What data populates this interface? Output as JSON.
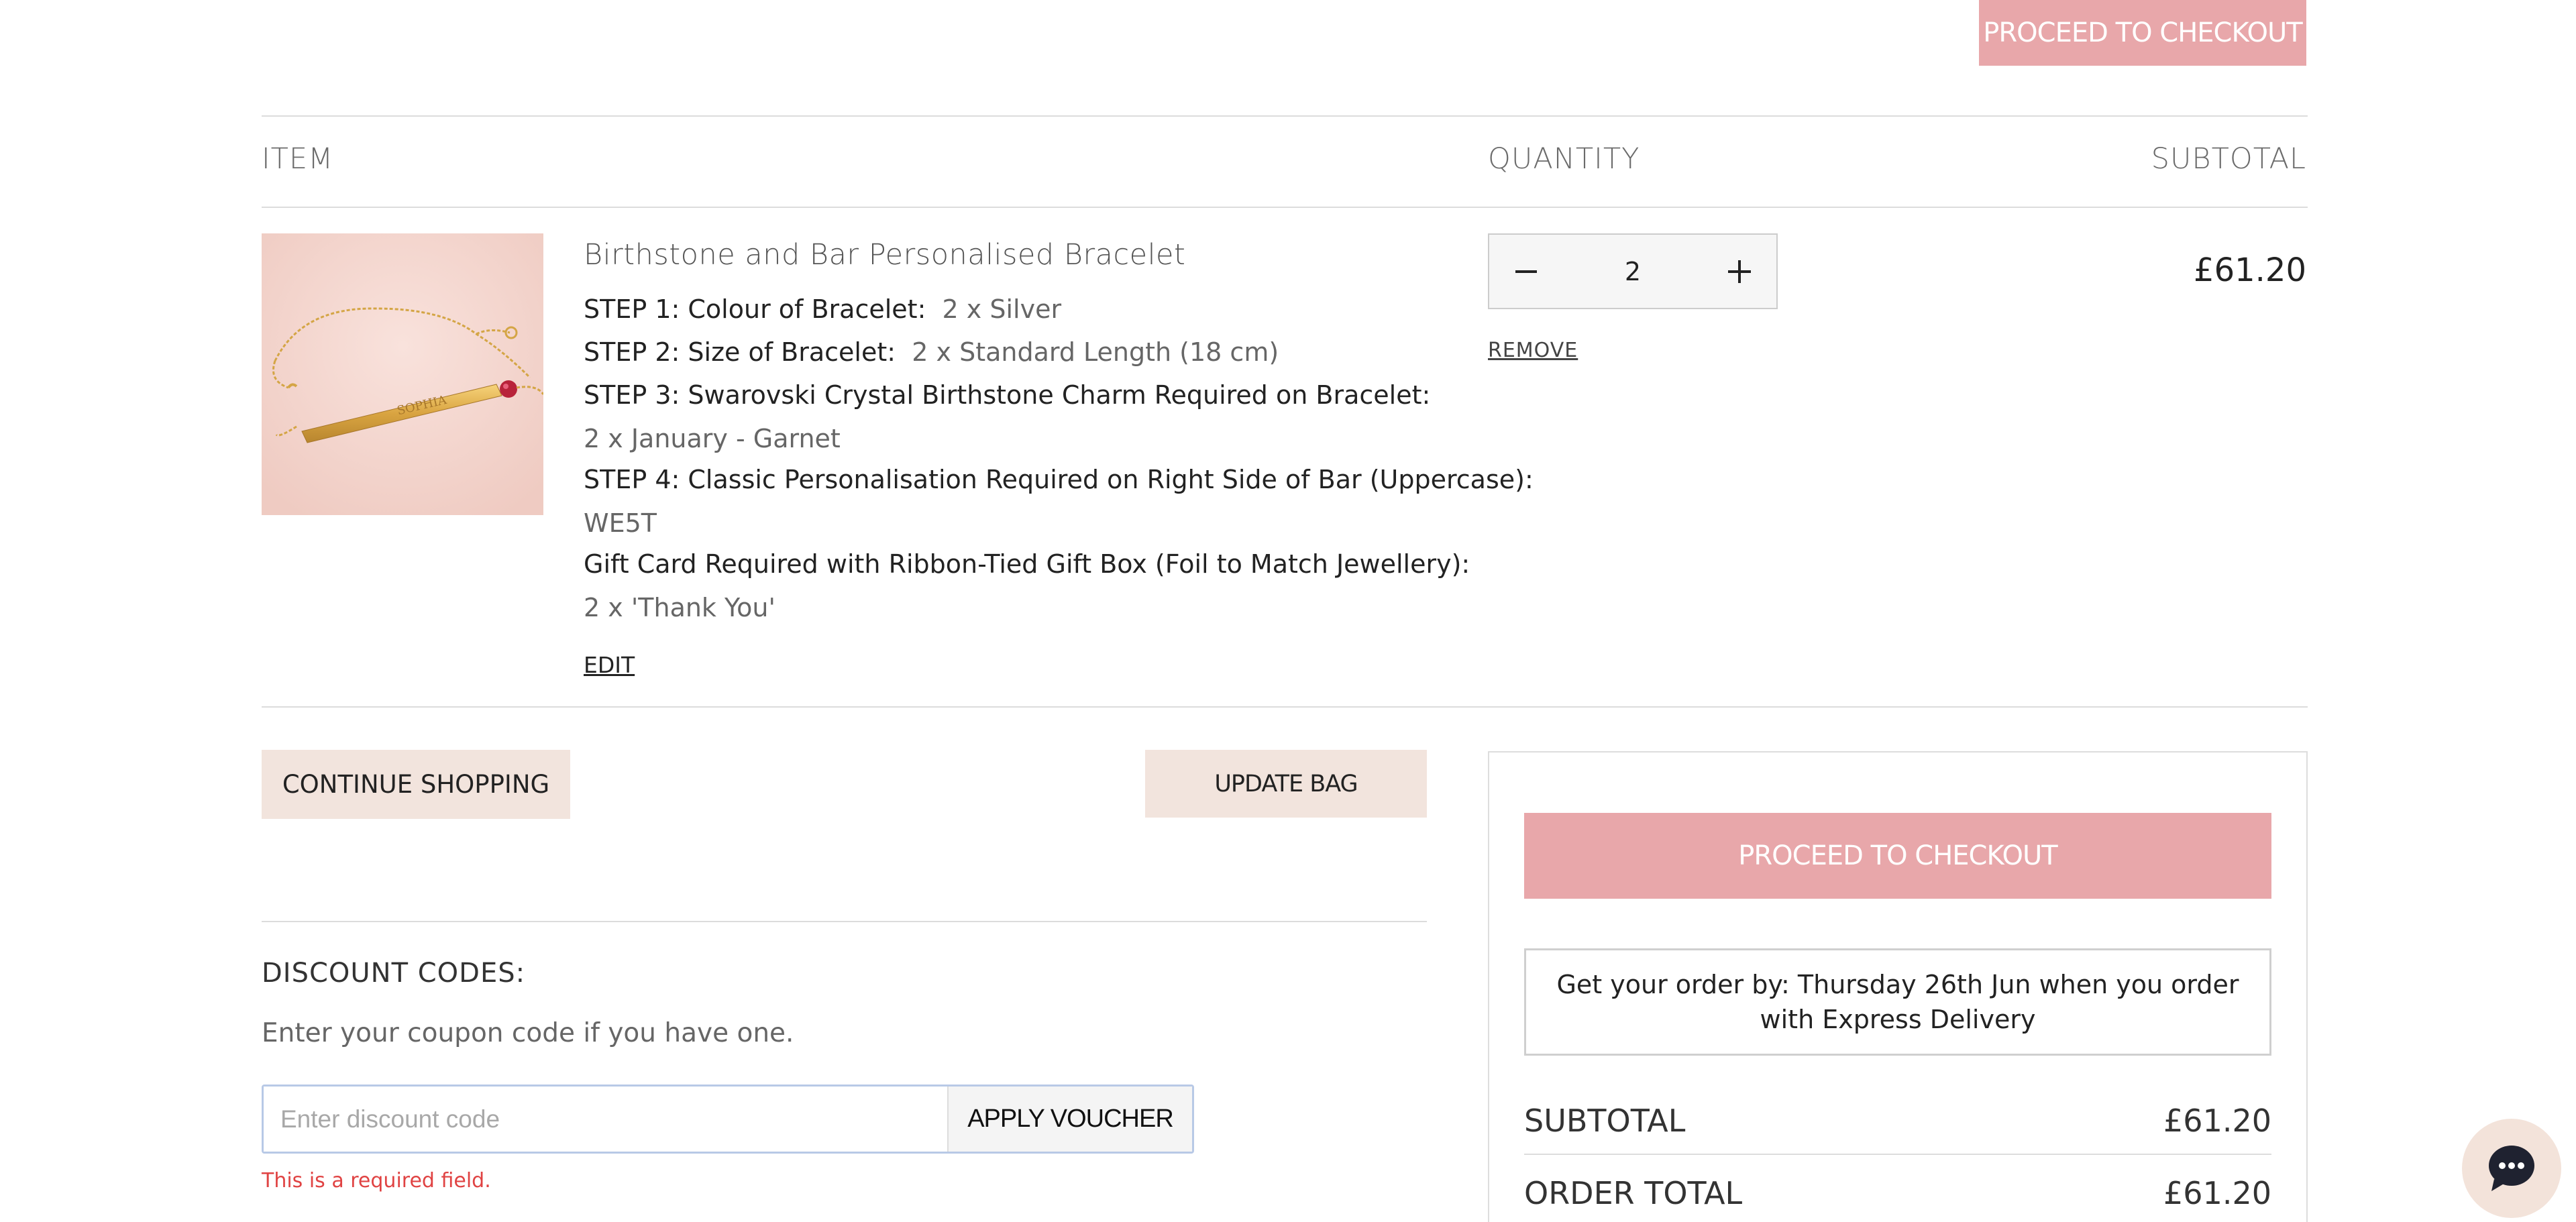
{
  "header": {
    "proceed_label": "PROCEED TO CHECKOUT"
  },
  "cart": {
    "columns": {
      "item": "ITEM",
      "quantity": "QUANTITY",
      "subtotal": "SUBTOTAL"
    },
    "item": {
      "name": "Birthstone and Bar Personalised Bracelet",
      "image_alt": "SOPHIA bracelet",
      "image_engraving": "SOPHIA",
      "options": [
        {
          "label": "STEP 1: Colour of Bracelet:",
          "value": "2 x Silver"
        },
        {
          "label": "STEP 2: Size of Bracelet:",
          "value": "2 x Standard Length (18 cm)"
        },
        {
          "label": "STEP 3: Swarovski Crystal Birthstone Charm Required on Bracelet:",
          "value": "2 x January - Garnet"
        },
        {
          "label": "STEP 4: Classic Personalisation Required on Right Side of Bar (Uppercase):",
          "value": "WE5T"
        },
        {
          "label": "Gift Card Required with Ribbon-Tied Gift Box (Foil to Match Jewellery):",
          "value": "2 x 'Thank You'"
        }
      ],
      "edit_label": "EDIT",
      "quantity": "2",
      "remove_label": "REMOVE",
      "subtotal": "£61.20"
    }
  },
  "actions": {
    "continue_label": "CONTINUE SHOPPING",
    "update_label": "UPDATE BAG"
  },
  "discount": {
    "title": "DISCOUNT CODES:",
    "help": "Enter your coupon code if you have one.",
    "placeholder": "Enter discount code",
    "value": "",
    "apply_label": "APPLY VOUCHER",
    "error": "This is a required field."
  },
  "summary": {
    "proceed_label": "PROCEED TO CHECKOUT",
    "delivery_text": "Get your order by: Thursday 26th Jun when you order with Express Delivery",
    "subtotal_label": "SUBTOTAL",
    "subtotal_value": "£61.20",
    "total_label": "ORDER TOTAL",
    "total_value": "£61.20"
  },
  "colors": {
    "accent_pink": "#e8a7aa",
    "beige": "#f2e4dd",
    "error_red": "#e04343"
  },
  "icons": {
    "minus": "minus-icon",
    "plus": "plus-icon",
    "chat": "chat-bubble-icon"
  }
}
